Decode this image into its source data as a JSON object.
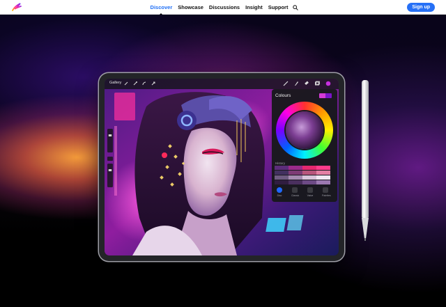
{
  "nav": {
    "logo_icon": "procreate-swirl-icon",
    "items": [
      {
        "label": "Discover",
        "active": true
      },
      {
        "label": "Showcase",
        "active": false
      },
      {
        "label": "Discussions",
        "active": false
      },
      {
        "label": "Insight",
        "active": false
      },
      {
        "label": "Support",
        "active": false
      }
    ],
    "search_icon": "search-icon",
    "signup_label": "Sign up",
    "accent_color": "#2670f6"
  },
  "device": {
    "toolbar": {
      "gallery_label": "Gallery",
      "left_icons": [
        "wrench-icon",
        "magic-wand-icon",
        "selection-icon",
        "move-arrow-icon"
      ],
      "right_icons": [
        "brush-icon",
        "smudge-icon",
        "eraser-icon",
        "layers-icon",
        "color-dot-icon"
      ]
    },
    "colours_panel": {
      "title": "Colours",
      "history_label": "History",
      "tabs": [
        "Disc",
        "Classic",
        "Value",
        "Palettes"
      ]
    }
  }
}
